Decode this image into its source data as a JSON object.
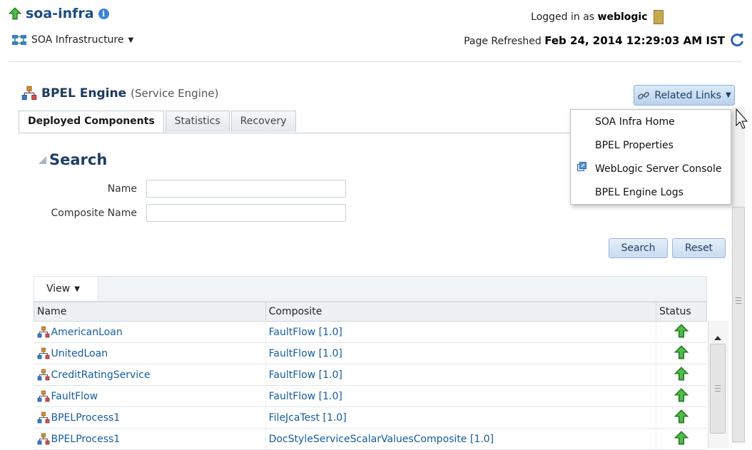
{
  "header": {
    "app_title": "soa-infra",
    "soa_menu_label": "SOA Infrastructure",
    "logged_in_prefix": "Logged in as",
    "logged_in_user": "weblogic",
    "refreshed_prefix": "Page Refreshed",
    "refreshed_time": "Feb 24, 2014 12:29:03 AM IST"
  },
  "engine": {
    "title": "BPEL Engine",
    "subtitle": "(Service Engine)"
  },
  "related_links": {
    "label": "Related Links",
    "items": [
      "SOA Infra Home",
      "BPEL Properties",
      "WebLogic Server Console",
      "BPEL Engine Logs"
    ]
  },
  "tabs": [
    {
      "label": "Deployed Components",
      "active": true
    },
    {
      "label": "Statistics",
      "active": false
    },
    {
      "label": "Recovery",
      "active": false
    }
  ],
  "search": {
    "title": "Search",
    "name_label": "Name",
    "name_value": "",
    "composite_label": "Composite Name",
    "composite_value": "",
    "search_button": "Search",
    "reset_button": "Reset"
  },
  "table": {
    "view_label": "View",
    "columns": [
      "Name",
      "Composite",
      "Status"
    ],
    "rows": [
      {
        "name": "AmericanLoan",
        "composite": "FaultFlow [1.0]",
        "status": "up"
      },
      {
        "name": "UnitedLoan",
        "composite": "FaultFlow [1.0]",
        "status": "up"
      },
      {
        "name": "CreditRatingService",
        "composite": "FaultFlow [1.0]",
        "status": "up"
      },
      {
        "name": "FaultFlow",
        "composite": "FaultFlow [1.0]",
        "status": "up"
      },
      {
        "name": "BPELProcess1",
        "composite": "FileJcaTest [1.0]",
        "status": "up"
      },
      {
        "name": "BPELProcess1",
        "composite": "DocStyleServiceScalarValuesComposite [1.0]",
        "status": "up"
      }
    ]
  },
  "colors": {
    "status_up": "#2e9a2a",
    "link": "#145c9e",
    "title": "#1c4c82"
  }
}
